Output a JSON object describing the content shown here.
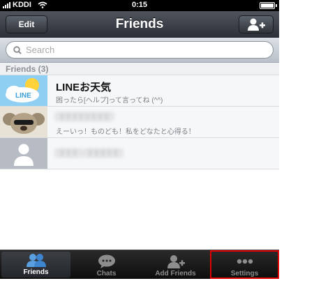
{
  "status_bar": {
    "carrier": "KDDI",
    "time": "0:15"
  },
  "nav": {
    "title": "Friends",
    "edit_label": "Edit"
  },
  "search": {
    "placeholder": "Search"
  },
  "section": {
    "header": "Friends (3)"
  },
  "friends": [
    {
      "name": "LINEお天気",
      "status": "困ったら[ヘルプ]って言ってね (^^)"
    },
    {
      "name": "□□□□□□□□□",
      "status": "えーいっ！ものども！私をどなたと心得る！"
    },
    {
      "name": "□□□□ □□□□□□",
      "status": ""
    }
  ],
  "tabs": [
    {
      "label": "Friends",
      "icon": "friends-icon",
      "active": true
    },
    {
      "label": "Chats",
      "icon": "chat-bubble-icon"
    },
    {
      "label": "Add Friends",
      "icon": "add-friend-icon"
    },
    {
      "label": "Settings",
      "icon": "more-dots-icon",
      "highlighted": true
    }
  ],
  "colors": {
    "highlight": "#e00000",
    "active_tab_icon": "#5aa0e0"
  }
}
